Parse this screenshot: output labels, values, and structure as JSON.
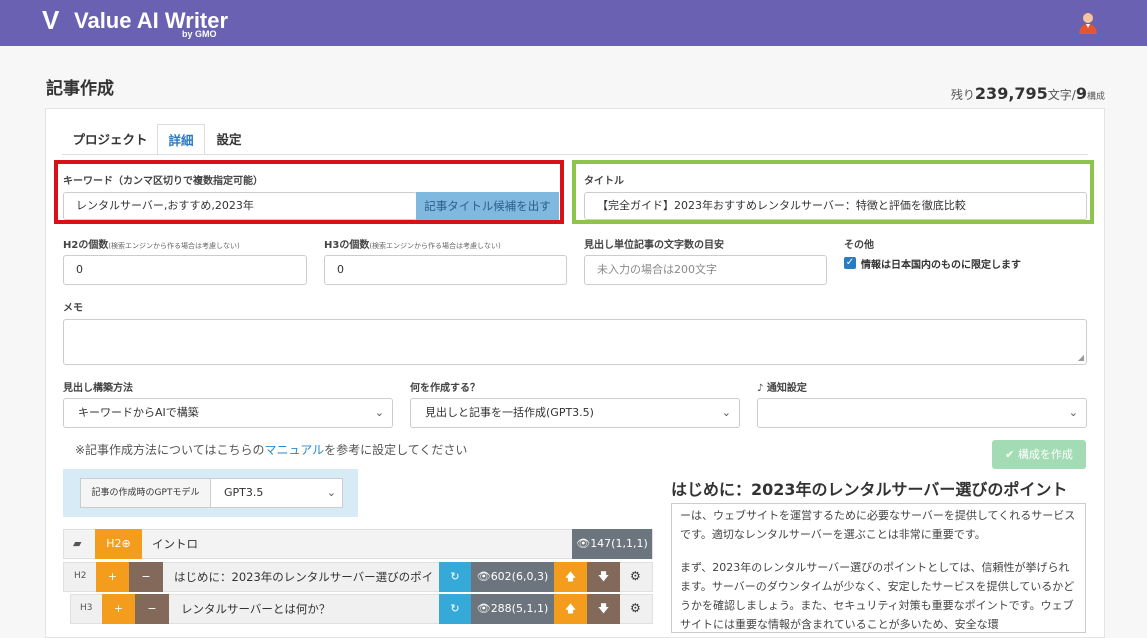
{
  "app": {
    "logo_mark": "V",
    "logo_text": "Value AI Writer",
    "logo_by": "by GMO"
  },
  "page": {
    "title": "記事作成",
    "remain_prefix": "残り",
    "remain_chars": "239,795",
    "remain_chars_unit": "文字/",
    "remain_count": "9",
    "remain_count_unit": "構成"
  },
  "tabs": [
    {
      "label": "プロジェクト"
    },
    {
      "label": "詳細"
    },
    {
      "label": "設定"
    }
  ],
  "form": {
    "keyword_label": "キーワード（カンマ区切りで複数指定可能）",
    "keyword_value": "レンタルサーバー,おすすめ,2023年",
    "keyword_button": "記事タイトル候補を出す",
    "title_label": "タイトル",
    "title_value": "【完全ガイド】2023年おすすめレンタルサーバー：特徴と評価を徹底比較",
    "h2_label": "H2の個数",
    "h2_note": "(検索エンジンから作る場合は考慮しない)",
    "h2_value": "0",
    "h3_label": "H3の個数",
    "h3_note": "(検索エンジンから作る場合は考慮しない)",
    "h3_value": "0",
    "length_label": "見出し単位記事の文字数の目安",
    "length_placeholder": "未入力の場合は200文字",
    "other_label": "その他",
    "other_checkbox": "情報は日本国内のものに限定します",
    "memo_label": "メモ",
    "method_label": "見出し構築方法",
    "method_value": "キーワードからAIで構築",
    "what_label": "何を作成する？",
    "what_value": "見出しと記事を一括作成(GPT3.5)",
    "notify_label": "♪ 通知設定",
    "notify_value": "",
    "note_prefix": "※記事作成方法についてはこちらの",
    "note_link": "マニュアル",
    "note_suffix": "を参考に設定してください",
    "compose_button": "構成を作成",
    "gpt_label": "記事の作成時のGPTモデル",
    "gpt_value": "GPT3.5"
  },
  "outline": [
    {
      "tag": "H2",
      "text": "イントロ",
      "views": "147(1,1,1)"
    },
    {
      "tag": "H2",
      "text": "はじめに：2023年のレンタルサーバー選びのポイ:",
      "views": "602(6,0,3)"
    },
    {
      "tag": "H3",
      "text": "レンタルサーバーとは何か？",
      "views": "288(5,1,1)"
    }
  ],
  "preview": {
    "title": "はじめに：2023年のレンタルサーバー選びのポイント",
    "paragraphs": [
      "ーは、ウェブサイトを運営するために必要なサーバーを提供してくれるサービスです。適切なレンタルサーバーを選ぶことは非常に重要です。",
      "まず、2023年のレンタルサーバー選びのポイントとしては、信頼性が挙げられます。サーバーのダウンタイムが少なく、安定したサービスを提供しているかどうかを確認しましょう。また、セキュリティ対策も重要なポイントです。ウェブサイトには重要な情報が含まれていることが多いため、安全な環"
    ]
  },
  "colors": {
    "header": "#6a61b3",
    "keyword_highlight": "#d8101a",
    "title_highlight": "#8dc44b",
    "accent": "#2b7bc0"
  }
}
